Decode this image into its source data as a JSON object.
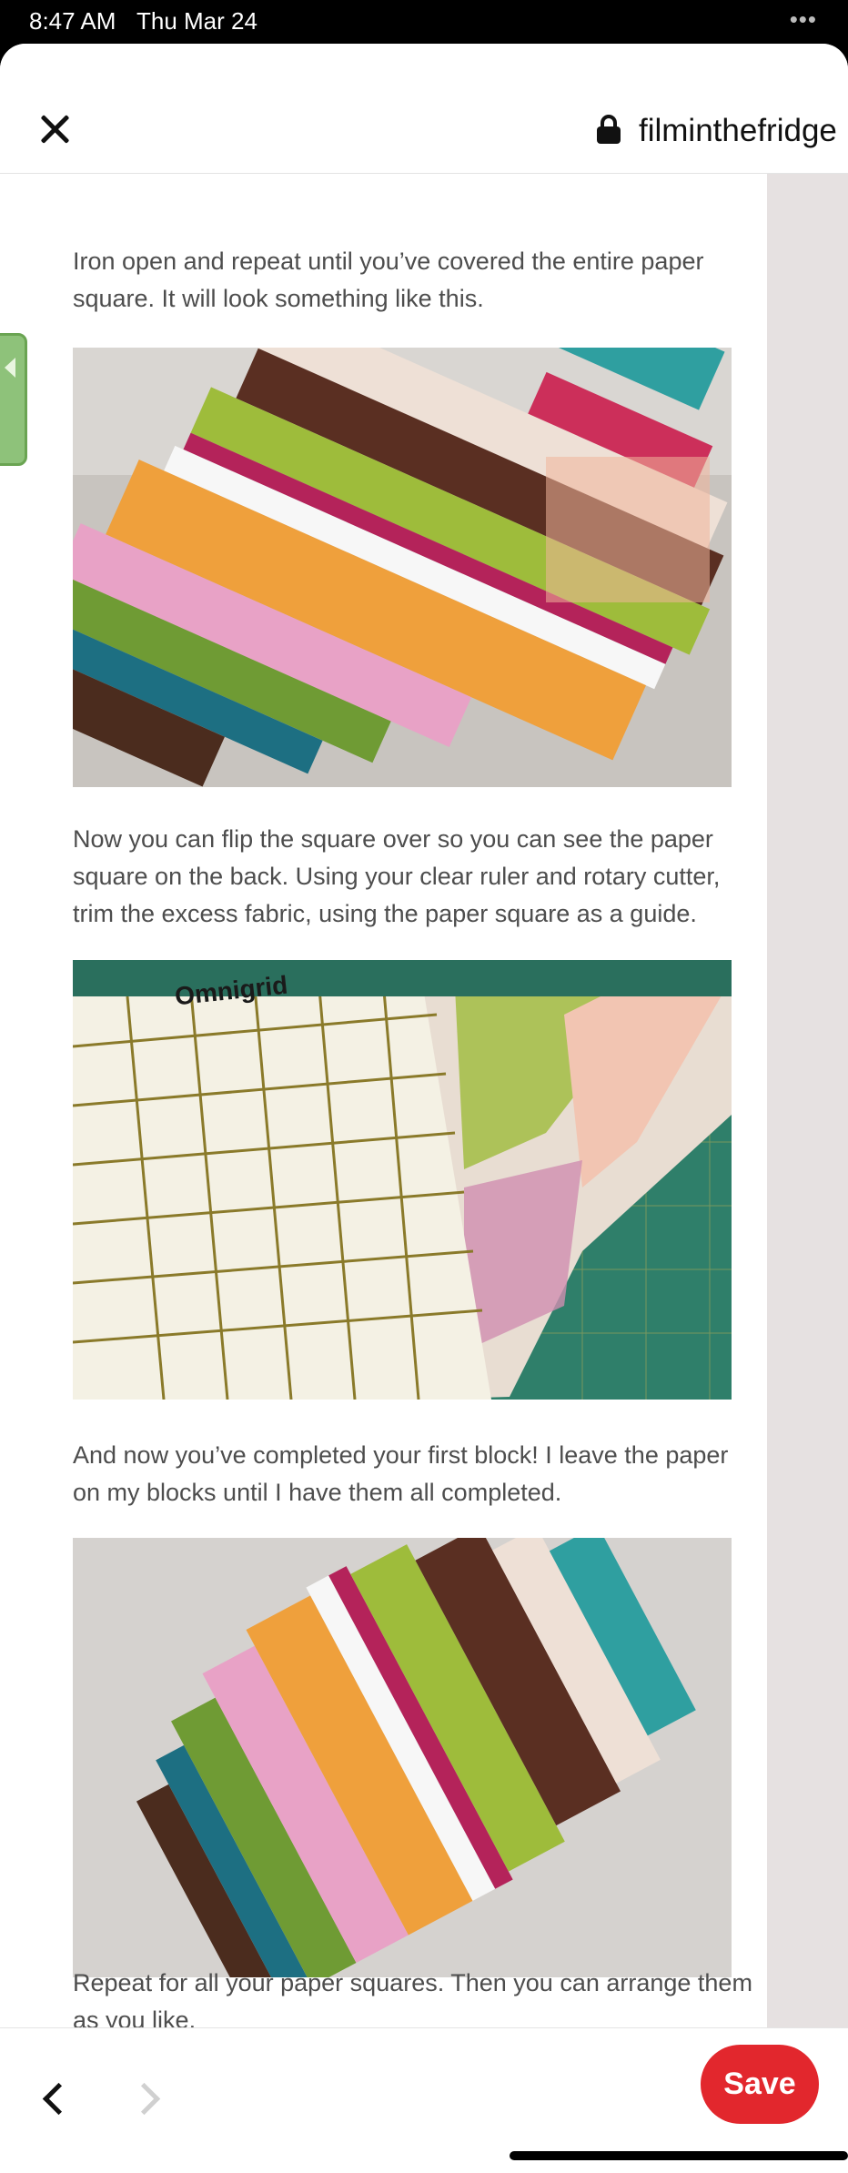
{
  "status_bar": {
    "time": "8:47 AM",
    "date": "Thu Mar 24",
    "dots": "•••"
  },
  "browser": {
    "url": "filminthefridge",
    "close_icon": "close-icon",
    "lock_icon": "lock-icon"
  },
  "article": {
    "paragraphs": [
      "Iron open and repeat until you’ve covered the entire paper square. It will look something like this.",
      "Now you can flip the square over so you can see the paper square on the back. Using your clear ruler and rotary cutter, trim the excess fabric, using the paper square as a guide.",
      "And now you’ve completed your first block! I leave the paper on my blocks until I have them all completed.",
      "Repeat for all your paper squares. Then you can arrange them as you like."
    ],
    "ruler_brand": "Omnigrid"
  },
  "bottom_bar": {
    "save_label": "Save",
    "back_icon": "chevron-left-icon",
    "forward_icon": "chevron-right-icon"
  },
  "colors": {
    "save": "#e2272d",
    "gutter": "#e6e1e1",
    "text": "#4d4d4d"
  }
}
